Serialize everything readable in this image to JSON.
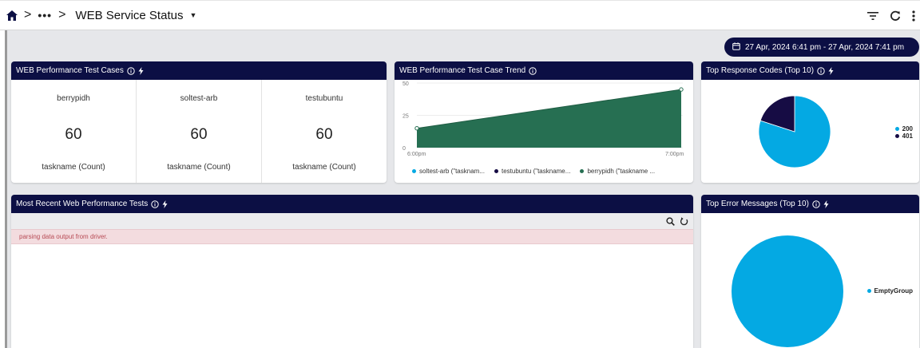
{
  "header": {
    "title": "WEB Service Status",
    "more": "•••",
    "separator": ">",
    "icons": {
      "home": "home-icon",
      "caret": "caret-down-icon",
      "filter": "filter-icon",
      "refresh": "refresh-icon",
      "menu": "kebab-menu-icon"
    }
  },
  "date_range": {
    "label": "27 Apr, 2024 6:41 pm - 27 Apr, 2024 7:41 pm",
    "icon": "calendar-icon"
  },
  "colors": {
    "navy": "#0c0f44",
    "cyan": "#04a9e3",
    "green": "#266f52",
    "error_text": "#b74b55",
    "error_bg": "#f3dcdf"
  },
  "panels": {
    "test_cases": {
      "title": "WEB Performance Test Cases",
      "items": [
        {
          "name": "berrypidh",
          "value": "60",
          "label": "taskname (Count)"
        },
        {
          "name": "soltest-arb",
          "value": "60",
          "label": "taskname (Count)"
        },
        {
          "name": "testubuntu",
          "value": "60",
          "label": "taskname (Count)"
        }
      ]
    },
    "trend": {
      "title": "WEB Performance Test Case Trend",
      "legend": [
        "soltest-arb (\"tasknam...",
        "testubuntu (\"taskname...",
        "berrypidh (\"taskname ..."
      ]
    },
    "response_codes": {
      "title": "Top Response Codes (Top 10)",
      "legend": [
        "200",
        "401"
      ]
    },
    "recent_tests": {
      "title": "Most Recent Web Performance Tests",
      "error_message": "parsing data output from driver."
    },
    "error_messages": {
      "title": "Top Error Messages (Top 10)",
      "legend": [
        "EmptyGroup"
      ]
    }
  },
  "chart_data": [
    {
      "type": "area",
      "title": "WEB Performance Test Case Trend",
      "x_ticks": [
        "6:00pm",
        "7:00pm"
      ],
      "y_ticks": [
        "0",
        "25",
        "50"
      ],
      "ylim": [
        0,
        50
      ],
      "series": [
        {
          "name": "berrypidh (\"taskname ...",
          "color": "#266f52",
          "x": [
            "6:41pm",
            "7:41pm"
          ],
          "values": [
            15,
            45
          ]
        }
      ]
    },
    {
      "type": "pie",
      "title": "Top Response Codes (Top 10)",
      "labels": [
        "200",
        "401"
      ],
      "values": [
        80,
        20
      ],
      "colors": [
        "#04a9e3",
        "#160c44"
      ]
    },
    {
      "type": "pie",
      "title": "Top Error Messages (Top 10)",
      "labels": [
        "EmptyGroup"
      ],
      "values": [
        100
      ],
      "colors": [
        "#04a9e3"
      ]
    }
  ]
}
